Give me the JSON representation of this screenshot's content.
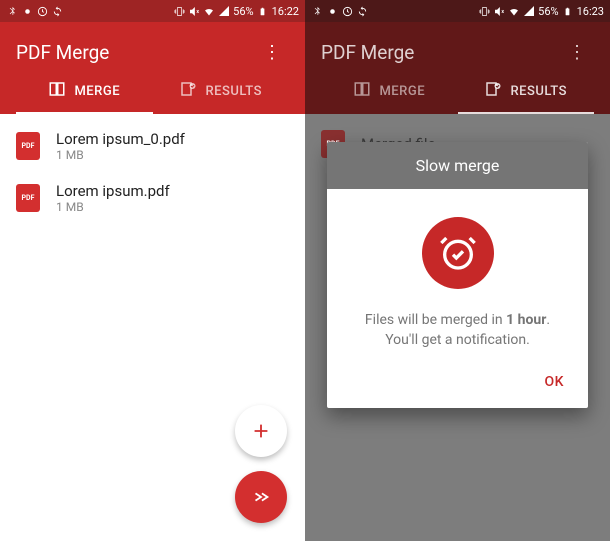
{
  "left": {
    "status": {
      "battery": "56%",
      "time": "16:22"
    },
    "app_title": "PDF Merge",
    "tabs": {
      "merge": "MERGE",
      "results": "RESULTS"
    },
    "files": [
      {
        "name": "Lorem ipsum_0.pdf",
        "size": "1 MB"
      },
      {
        "name": "Lorem ipsum.pdf",
        "size": "1 MB"
      }
    ]
  },
  "right": {
    "status": {
      "battery": "56%",
      "time": "16:23"
    },
    "app_title": "PDF Merge",
    "tabs": {
      "merge": "MERGE",
      "results": "RESULTS"
    },
    "file_name": "Merged file",
    "dialog": {
      "title": "Slow merge",
      "text_prefix": "Files will be merged in ",
      "text_bold": "1 hour",
      "text_suffix": ".",
      "text_line2": "You'll get a notification.",
      "ok": "OK"
    }
  }
}
